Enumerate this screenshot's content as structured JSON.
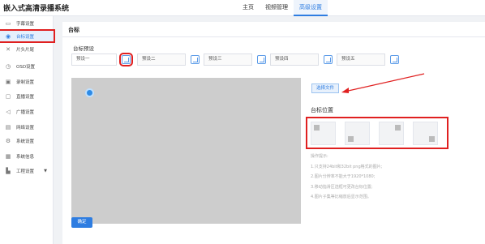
{
  "app_title": "嵌入式高清录播系统",
  "nav": {
    "home": "主页",
    "video": "视频管理",
    "advanced": "高级设置"
  },
  "sidebar": {
    "items": [
      {
        "icon": "monitor-icon",
        "label": "字幕设置"
      },
      {
        "icon": "logo-icon",
        "label": "台标设置"
      },
      {
        "icon": "pan-tilt-icon",
        "label": "片头片尾"
      },
      {
        "icon": "osd-icon",
        "label": "OSD设置"
      },
      {
        "icon": "record-icon",
        "label": "录制设置"
      },
      {
        "icon": "live-icon",
        "label": "直播设置"
      },
      {
        "icon": "broadcast-icon",
        "label": "广播设置"
      },
      {
        "icon": "network-icon",
        "label": "网络设置"
      },
      {
        "icon": "system-icon",
        "label": "系统设置"
      },
      {
        "icon": "info-icon",
        "label": "系统信息"
      },
      {
        "icon": "tools-icon",
        "label": "工程设置"
      }
    ]
  },
  "main": {
    "title": "台标",
    "preset_label": "台标预设",
    "presets": [
      "预设一",
      "预设二",
      "预设三",
      "预设四",
      "预设五"
    ],
    "choose_file": "选择文件",
    "position_label": "台标位置",
    "tips": [
      "操作提示:",
      "1.只支持24bit和32bit png格式的图片;",
      "2.图片分辨率不能大于1920*1080;",
      "3.移动指滑区选框可更改台标位置;",
      "4.图片子集等比缩放后显示范围。"
    ],
    "confirm": "确定"
  },
  "colors": {
    "accent": "#2e7de1",
    "highlight": "#e02020"
  }
}
